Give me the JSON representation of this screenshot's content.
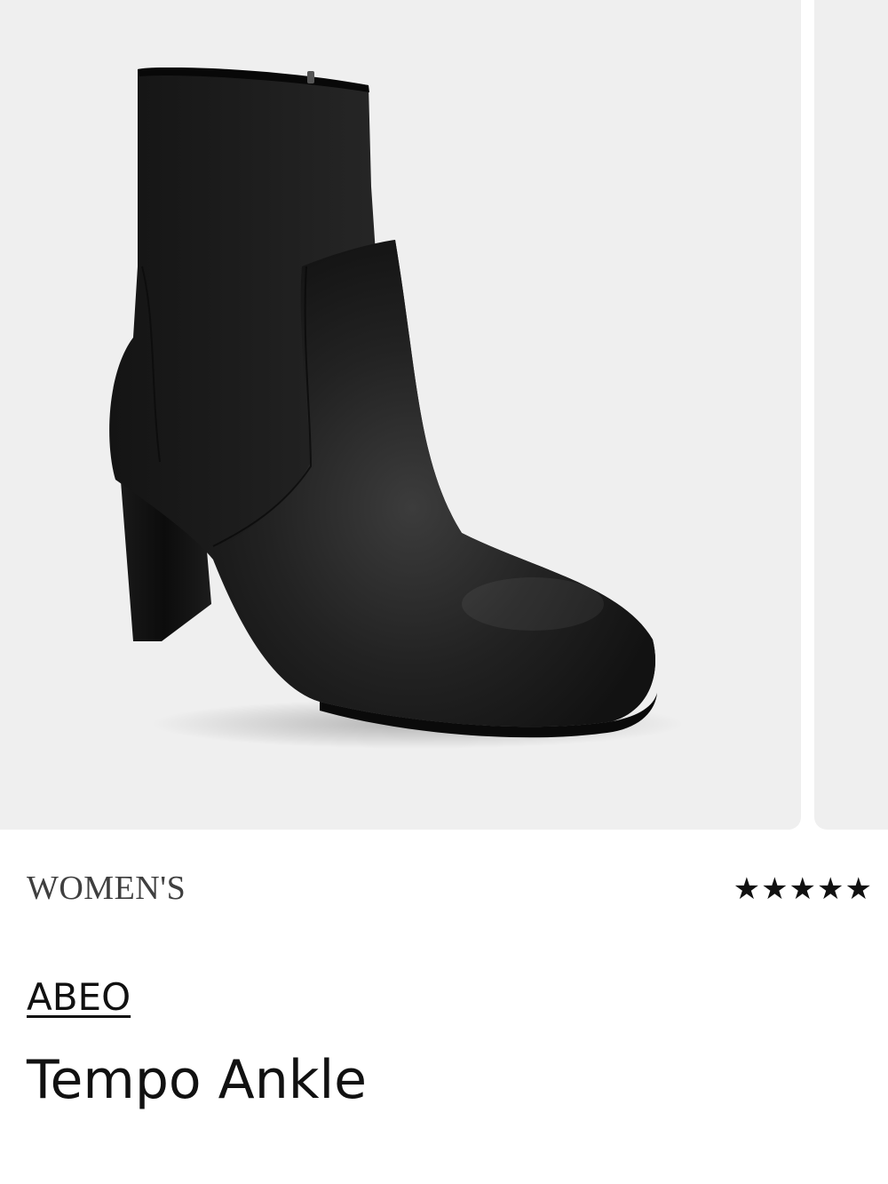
{
  "product": {
    "category": "WOMEN'S",
    "brand": "ABEO",
    "name": "Tempo Ankle",
    "rating": {
      "value": 5,
      "max": 5
    }
  },
  "gallery": {
    "image_subject": "black leather ankle boot",
    "background_color": "#efefef",
    "slides_visible": 2
  },
  "icons": {
    "star": "star-icon"
  },
  "colors": {
    "text": "#111111",
    "category_text": "#3f3f3f",
    "image_bg": "#efefef"
  }
}
